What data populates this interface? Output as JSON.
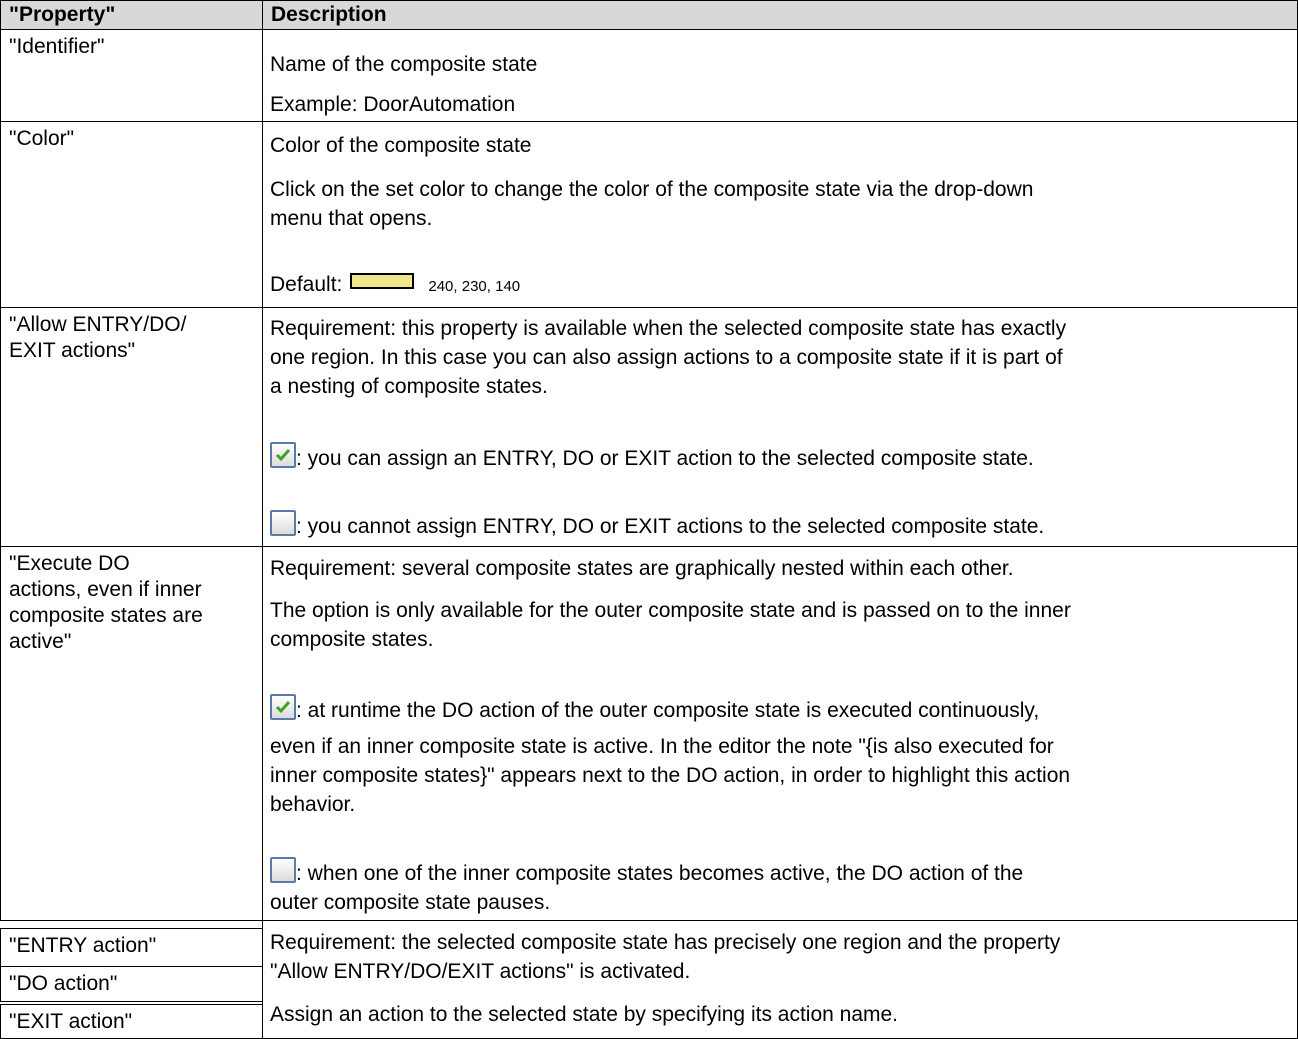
{
  "header": {
    "property": "\"Property\"",
    "description": "Description"
  },
  "rows": {
    "identifier": {
      "property": "\"Identifier\"",
      "line1": "Name of the composite state",
      "line2": "Example: DoorAutomation"
    },
    "color": {
      "property": "\"Color\"",
      "line1": "Color of the composite state",
      "line2": "Click on the set color to change the color of the composite state via the drop-down",
      "line3": "menu that opens.",
      "default_label": "Default:",
      "default_value": "240, 230, 140",
      "swatch_color": "#f0e68c"
    },
    "allow_actions": {
      "property_l1": "\"Allow ENTRY/DO/",
      "property_l2": "EXIT actions\"",
      "req_l1": "Requirement: this property is available when the selected composite state has exactly",
      "req_l2": "one region. In this case you can also assign actions to a composite state if it is part of",
      "req_l3": "a nesting of composite states.",
      "checked_text": ": you can assign an ENTRY, DO or EXIT action to the selected composite state.",
      "unchecked_text": ": you cannot assign ENTRY, DO or EXIT actions to the selected composite state."
    },
    "execute_do": {
      "property_l1": "\"Execute DO",
      "property_l2": "actions, even if inner",
      "property_l3": "composite states are",
      "property_l4": "active\"",
      "req": "Requirement: several composite states are graphically nested within each other.",
      "opt_l1": "The option is only available for the outer composite state and is passed on to the inner",
      "opt_l2": "composite states.",
      "checked_l1": ": at runtime the DO action of the outer composite state is executed continuously,",
      "checked_l2": "even if an inner composite state is active. In the editor the note \"{is also executed for",
      "checked_l3": "inner composite states}\" appears next to the DO action, in order to highlight this action",
      "checked_l4": "behavior.",
      "unchecked_l1": ": when one of the inner composite states becomes active, the DO action of the",
      "unchecked_l2": "outer composite state pauses."
    },
    "actions": {
      "entry": "\"ENTRY action\"",
      "do": "\"DO action\"",
      "exit": "\"EXIT action\"",
      "req_l1": "Requirement: the selected composite state has precisely one region and the property",
      "req_l2": "\"Allow ENTRY/DO/EXIT actions\" is activated.",
      "assign": "Assign an action to the selected state by specifying its action name."
    }
  },
  "icons": {
    "checked": "checkbox-checked-icon",
    "unchecked": "checkbox-unchecked-icon"
  },
  "colors": {
    "header_bg": "#d8d8d8",
    "check_green": "#3aa51f",
    "checkbox_border": "#5a7ba6"
  }
}
